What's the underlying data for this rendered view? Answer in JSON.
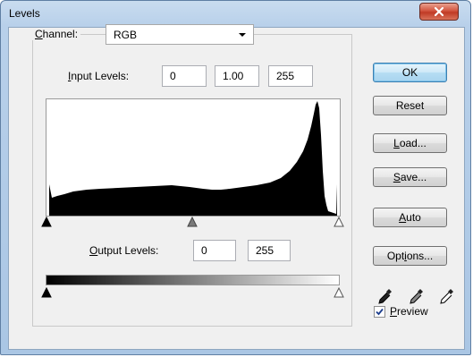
{
  "window": {
    "title": "Levels"
  },
  "channel": {
    "label_prefix": "",
    "label_underlined": "C",
    "label_rest": "hannel:",
    "value": "RGB"
  },
  "input_levels": {
    "label_pre": "",
    "label_u": "I",
    "label_post": "nput Levels:",
    "black": "0",
    "gamma": "1.00",
    "white": "255"
  },
  "output_levels": {
    "label_u": "O",
    "label_post": "utput Levels:",
    "black": "0",
    "white": "255"
  },
  "buttons": {
    "ok": "OK",
    "reset": "Reset",
    "load_u": "L",
    "load_rest": "oad...",
    "save_u": "S",
    "save_rest": "ave...",
    "auto_u": "A",
    "auto_rest": "uto",
    "options_pre": "Opt",
    "options_u": "i",
    "options_post": "ons..."
  },
  "preview": {
    "checked": true,
    "label_u": "P",
    "label_rest": "review"
  },
  "icons": [
    "close-icon",
    "dropdown-arrow-icon",
    "black-eyedropper-icon",
    "gray-eyedropper-icon",
    "white-eyedropper-icon",
    "checkmark-icon"
  ],
  "colors": {
    "default_button_border": "#3c7fb1",
    "close_button": "#c03a25",
    "histogram_fill": "#000000"
  }
}
